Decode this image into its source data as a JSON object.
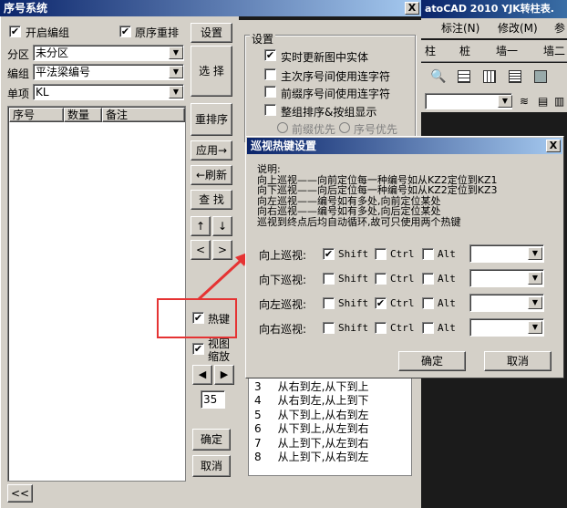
{
  "main_window": {
    "title": "序号系统",
    "close": "X",
    "enable_group": "开启编组",
    "reorder_label": "原序重排",
    "zone_label": "分区",
    "zone_value": "未分区",
    "group_label": "编组",
    "group_value": "平法梁编号",
    "item_label": "单项",
    "item_value": "KL",
    "columns": [
      "序号",
      "数量",
      "备注"
    ],
    "settings_btn": "设置>>",
    "select_btn": "选 择",
    "resort_btn": "重排序",
    "apply_btn": "应用→",
    "refresh_btn": "←刷新",
    "find_btn": "查 找",
    "up_btn": "↑",
    "down_btn": "↓",
    "left_btn": "<",
    "right_btn": ">",
    "hotkey_label": "热键",
    "view_zoom_label_1": "视图",
    "view_zoom_label_2": "缩放",
    "prev_btn": "◀",
    "next_btn": "▶",
    "zoom_value": "35",
    "ok_btn": "确定",
    "cancel_btn": "取消",
    "collapse_btn": "<<"
  },
  "settings_panel": {
    "title": "设置",
    "opt1": "实时更新图中实体",
    "opt2": "主次序号间使用连字符",
    "opt3": "前缀序号间使用连字符",
    "opt4": "整组排序&按组显示",
    "radio1": "前缀优先",
    "radio2": "序号优先",
    "order_rows": [
      {
        "n": "3",
        "t": "从右到左,从下到上"
      },
      {
        "n": "4",
        "t": "从右到左,从上到下"
      },
      {
        "n": "5",
        "t": "从下到上,从右到左"
      },
      {
        "n": "6",
        "t": "从下到上,从左到右"
      },
      {
        "n": "7",
        "t": "从上到下,从左到右"
      },
      {
        "n": "8",
        "t": "从上到下,从右到左"
      }
    ]
  },
  "cad_bg": {
    "title": "atoCAD 2010  YJK转柱表.",
    "menu1": "标注(N)",
    "menu2": "修改(M)",
    "menu3": "参",
    "tab1": "柱",
    "tab2": "桩",
    "tab3": "墙一",
    "tab4": "墙二"
  },
  "hotkey_dialog": {
    "title": "巡视热键设置",
    "close": "X",
    "desc_title": "说明:",
    "desc_lines": [
      "向上巡视——向前定位每一种编号如从KZ2定位到KZ1",
      "向下巡视——向后定位每一种编号如从KZ2定位到KZ3",
      "向左巡视——编号如有多处,向前定位某处",
      "向右巡视——编号如有多处,向后定位某处",
      "巡视到终点后均自动循环,故可只使用两个热键"
    ],
    "rows": [
      {
        "label": "向上巡视:",
        "shift": true,
        "ctrl": false,
        "alt": false
      },
      {
        "label": "向下巡视:",
        "shift": false,
        "ctrl": false,
        "alt": false
      },
      {
        "label": "向左巡视:",
        "shift": false,
        "ctrl": true,
        "alt": false
      },
      {
        "label": "向右巡视:",
        "shift": false,
        "ctrl": false,
        "alt": false
      }
    ],
    "shift_label": "Shift",
    "ctrl_label": "Ctrl",
    "alt_label": "Alt",
    "ok_btn": "确定",
    "cancel_btn": "取消"
  },
  "check_mark": "✔",
  "colors": {
    "highlight": "#e53333",
    "title_bar": "#0a246a"
  }
}
